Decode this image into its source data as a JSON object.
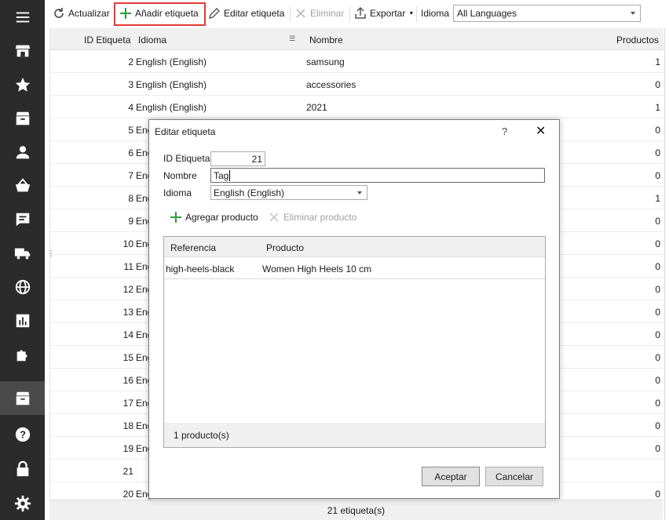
{
  "sidebar": {
    "items": [
      {
        "icon": "menu-icon"
      },
      {
        "icon": "store-icon"
      },
      {
        "icon": "star-icon"
      },
      {
        "icon": "archive-icon"
      },
      {
        "icon": "user-icon"
      },
      {
        "icon": "basket-icon"
      },
      {
        "icon": "chat-icon"
      },
      {
        "icon": "truck-icon"
      },
      {
        "icon": "globe-icon"
      },
      {
        "icon": "chart-icon"
      },
      {
        "icon": "puzzle-icon"
      },
      {
        "icon": "tags-archive-icon"
      },
      {
        "icon": "help-icon"
      },
      {
        "icon": "lock-icon"
      },
      {
        "icon": "gear-icon"
      }
    ]
  },
  "toolbar": {
    "refresh_label": "Actualizar",
    "add_label": "Añadir etiqueta",
    "edit_label": "Editar etiqueta",
    "delete_label": "Eliminar",
    "export_label": "Exportar",
    "language_label": "Idioma",
    "language_value": "All Languages"
  },
  "grid": {
    "headers": {
      "id": "ID Etiqueta",
      "language": "Idioma",
      "name": "Nombre",
      "products": "Productos"
    },
    "rows": [
      {
        "id": "2",
        "language": "English (English)",
        "name": "samsung",
        "products": "1"
      },
      {
        "id": "3",
        "language": "English (English)",
        "name": "accessories",
        "products": "0"
      },
      {
        "id": "4",
        "language": "English (English)",
        "name": "2021",
        "products": "1"
      },
      {
        "id": "5",
        "language": "Eng",
        "name": "",
        "products": "0"
      },
      {
        "id": "6",
        "language": "Eng",
        "name": "",
        "products": "0"
      },
      {
        "id": "7",
        "language": "Eng",
        "name": "",
        "products": "0"
      },
      {
        "id": "8",
        "language": "Eng",
        "name": "",
        "products": "1"
      },
      {
        "id": "9",
        "language": "Eng",
        "name": "",
        "products": "0"
      },
      {
        "id": "10",
        "language": "Eng",
        "name": "",
        "products": "0"
      },
      {
        "id": "11",
        "language": "Eng",
        "name": "",
        "products": "0"
      },
      {
        "id": "12",
        "language": "Eng",
        "name": "",
        "products": "0"
      },
      {
        "id": "13",
        "language": "Eng",
        "name": "",
        "products": "0"
      },
      {
        "id": "14",
        "language": "Eng",
        "name": "",
        "products": "0"
      },
      {
        "id": "15",
        "language": "Eng",
        "name": "",
        "products": "0"
      },
      {
        "id": "16",
        "language": "Eng",
        "name": "",
        "products": "0"
      },
      {
        "id": "17",
        "language": "Eng",
        "name": "",
        "products": "0"
      },
      {
        "id": "18",
        "language": "Eng",
        "name": "",
        "products": "0"
      },
      {
        "id": "19",
        "language": "Eng",
        "name": "",
        "products": "0"
      },
      {
        "id": "21",
        "language": "",
        "name": "",
        "products": ""
      },
      {
        "id": "20",
        "language": "Eng",
        "name": "",
        "products": "0"
      }
    ],
    "footer": "21 etiqueta(s)"
  },
  "dialog": {
    "title": "Editar etiqueta",
    "help": "?",
    "id_label": "ID Etiqueta",
    "id_value": "21",
    "name_label": "Nombre",
    "name_value": "Tag",
    "language_label": "Idioma",
    "language_value": "English (English)",
    "add_product_label": "Agregar producto",
    "remove_product_label": "Eliminar producto",
    "products_headers": {
      "reference": "Referencia",
      "product": "Producto"
    },
    "products_rows": [
      {
        "reference": "high-heels-black",
        "product": "Women High Heels 10 cm"
      }
    ],
    "products_footer": "1 producto(s)",
    "accept_label": "Aceptar",
    "cancel_label": "Cancelar"
  },
  "colors": {
    "sidebar_bg": "#2b2b2b",
    "highlight_border": "#e53935",
    "add_icon_green": "#2e9e3e"
  }
}
